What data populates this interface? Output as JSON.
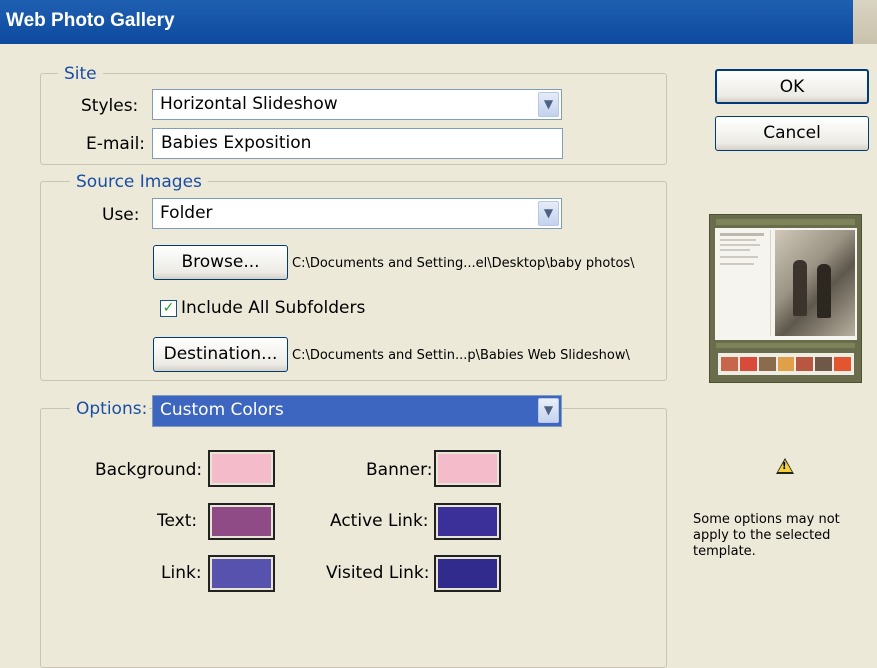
{
  "window": {
    "title": "Web Photo Gallery"
  },
  "site": {
    "legend": "Site",
    "styles_label": "Styles:",
    "styles_value": "Horizontal Slideshow",
    "email_label": "E-mail:",
    "email_value": "Babies Exposition"
  },
  "source": {
    "legend": "Source Images",
    "use_label": "Use:",
    "use_value": "Folder",
    "browse_label": "Browse...",
    "browse_path": "C:\\Documents and Setting...el\\Desktop\\baby photos\\",
    "include_subfolders_label": "Include All Subfolders",
    "include_subfolders_checked": true,
    "destination_label": "Destination...",
    "destination_path": "C:\\Documents and Settin...p\\Babies Web Slideshow\\"
  },
  "options": {
    "legend": "Options:",
    "value": "Custom Colors",
    "colors": {
      "background": {
        "label": "Background:",
        "hex": "#f4bccb"
      },
      "banner": {
        "label": "Banner:",
        "hex": "#f4bccb"
      },
      "text": {
        "label": "Text:",
        "hex": "#8e4b86"
      },
      "active_link": {
        "label": "Active Link:",
        "hex": "#3b2f9a"
      },
      "link": {
        "label": "Link:",
        "hex": "#5752ad"
      },
      "visited_link": {
        "label": "Visited Link:",
        "hex": "#322b8e"
      }
    }
  },
  "buttons": {
    "ok": "OK",
    "cancel": "Cancel"
  },
  "warning": {
    "icon": "warning-icon",
    "text": "Some options may not apply to the selected template."
  },
  "colors": {
    "titlebar": "#0d4aa0",
    "dialog_bg": "#ece9d8",
    "legend_text": "#1a4ea6",
    "selection": "#3d66c0"
  }
}
